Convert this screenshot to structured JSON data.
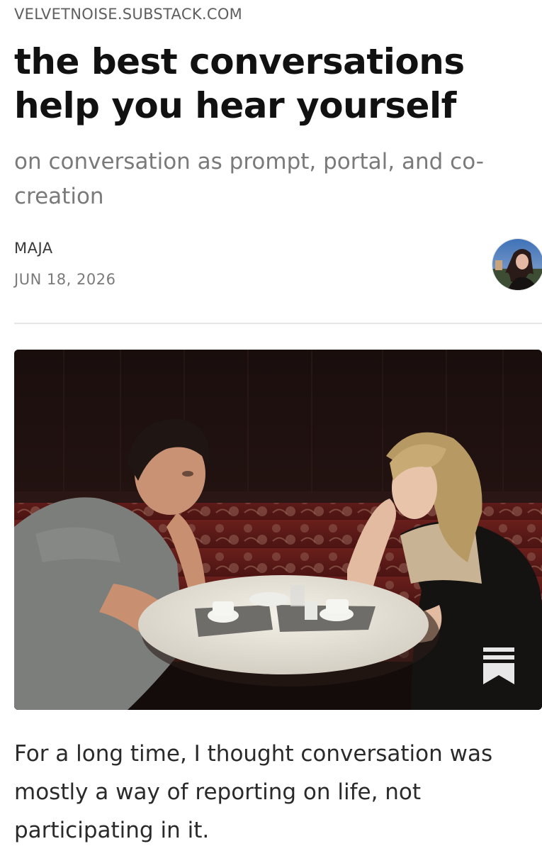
{
  "publication": {
    "domain": "VELVETNOISE.SUBSTACK.COM"
  },
  "post": {
    "title": "the best conversations help you hear yourself",
    "subtitle": "on conversation as prompt, portal, and co-creation",
    "author": "MAJA",
    "date": "JUN 18, 2026",
    "body_paragraph": "For a long time, I thought conversation was mostly a way of reporting on life, not participating in it."
  },
  "icons": {
    "bookmark": "bookmark-icon",
    "avatar": "author-avatar"
  },
  "colors": {
    "title": "#111111",
    "subtitle": "#7a7a7a",
    "divider": "#e6e6e6",
    "bookmark": "#ffffff"
  }
}
